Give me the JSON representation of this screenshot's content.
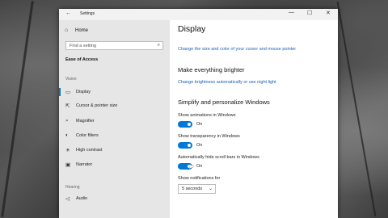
{
  "window": {
    "title": "Settings",
    "back_glyph": "←",
    "minimize_glyph": "—",
    "maximize_glyph": "☐",
    "close_glyph": "✕"
  },
  "sidebar": {
    "home_label": "Home",
    "search_placeholder": "Find a setting",
    "section_title": "Ease of Access",
    "group_vision": "Vision",
    "group_hearing": "Hearing",
    "items": [
      {
        "label": "Display",
        "icon": "display-icon",
        "glyph": "▭"
      },
      {
        "label": "Cursor & pointer size",
        "icon": "cursor-icon",
        "glyph": "⇱"
      },
      {
        "label": "Magnifier",
        "icon": "magnifier-icon",
        "glyph": "⌕"
      },
      {
        "label": "Color filters",
        "icon": "color-filters-icon",
        "glyph": "◐"
      },
      {
        "label": "High contrast",
        "icon": "high-contrast-icon",
        "glyph": "☀"
      },
      {
        "label": "Narrator",
        "icon": "narrator-icon",
        "glyph": "▣"
      },
      {
        "label": "Audio",
        "icon": "audio-icon",
        "glyph": "◁"
      }
    ]
  },
  "main": {
    "page_title": "Display",
    "link_cursor": "Change the size and color of your cursor and mouse pointer",
    "heading_brighter": "Make everything brighter",
    "link_brightness": "Change brightness automatically or use night light",
    "heading_simplify": "Simplify and personalize Windows",
    "toggles": [
      {
        "label": "Show animations in Windows",
        "state": "On"
      },
      {
        "label": "Show transparency in Windows",
        "state": "On"
      },
      {
        "label": "Automatically hide scroll bars in Windows",
        "state": "On"
      }
    ],
    "notifications_label": "Show notifications for",
    "notifications_value": "5 seconds"
  },
  "colors": {
    "accent": "#0078d7",
    "link": "#1a5fb4"
  }
}
